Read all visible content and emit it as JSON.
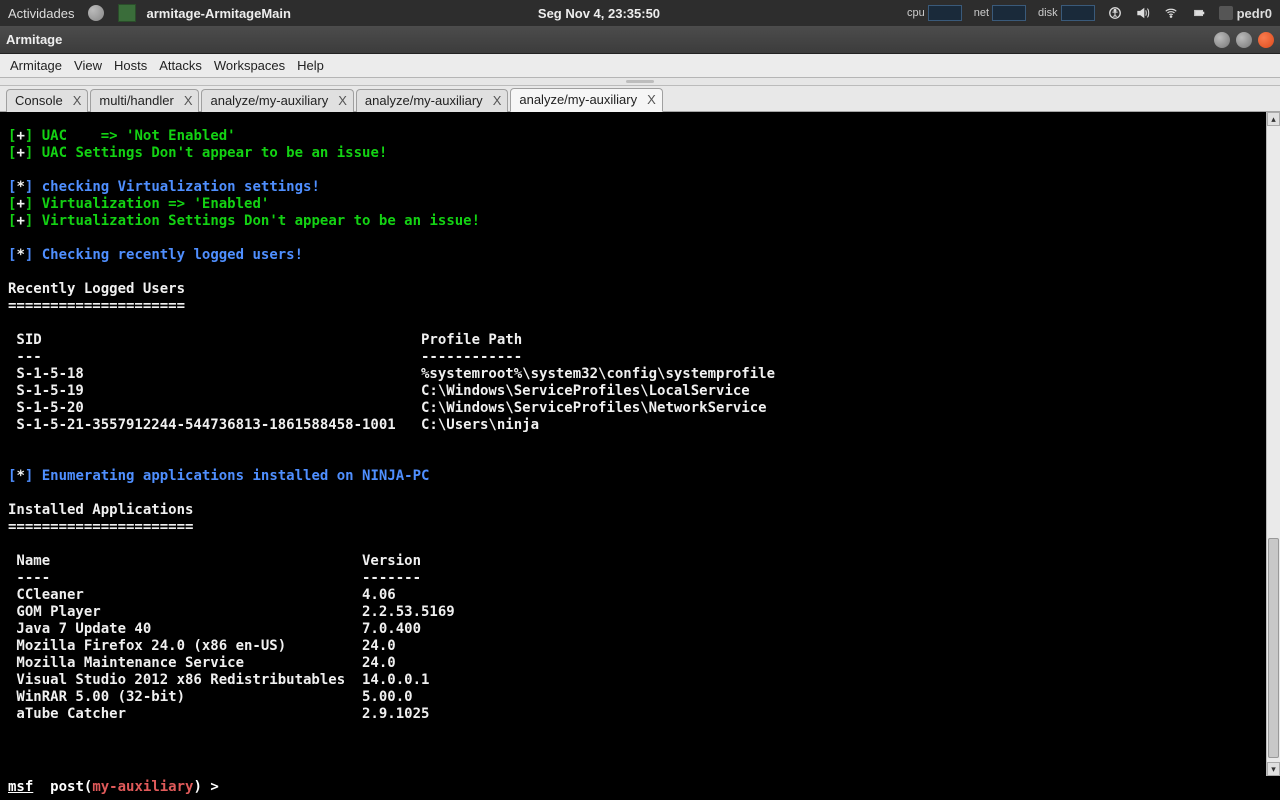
{
  "gnome": {
    "activities": "Actividades",
    "task_title": "armitage-ArmitageMain",
    "clock": "Seg Nov  4, 23:35:50",
    "indicators": {
      "cpu_label": "cpu",
      "net_label": "net",
      "disk_label": "disk"
    },
    "user": "pedr0"
  },
  "window": {
    "title": "Armitage"
  },
  "menu": {
    "items": [
      "Armitage",
      "View",
      "Hosts",
      "Attacks",
      "Workspaces",
      "Help"
    ]
  },
  "tabs": [
    {
      "label": "Console",
      "active": false
    },
    {
      "label": "multi/handler",
      "active": false
    },
    {
      "label": "analyze/my-auxiliary",
      "active": false
    },
    {
      "label": "analyze/my-auxiliary",
      "active": false
    },
    {
      "label": "analyze/my-auxiliary",
      "active": true
    }
  ],
  "console": {
    "lines": [
      {
        "t": "tag",
        "tag": "[+]",
        "text": "UAC    => 'Not Enabled'"
      },
      {
        "t": "tag",
        "tag": "[+]",
        "text": "UAC Settings Don't appear to be an issue!"
      },
      {
        "t": "blank"
      },
      {
        "t": "tag",
        "tag": "[*]",
        "text": "checking Virtualization settings!"
      },
      {
        "t": "tag",
        "tag": "[+]",
        "text": "Virtualization => 'Enabled'"
      },
      {
        "t": "tag",
        "tag": "[+]",
        "text": "Virtualization Settings Don't appear to be an issue!"
      },
      {
        "t": "blank"
      },
      {
        "t": "tag",
        "tag": "[*]",
        "text": "Checking recently logged users!"
      },
      {
        "t": "blank"
      }
    ],
    "users_header": "Recently Logged Users",
    "users_rule": "=====================",
    "users_table": {
      "col1_header": "SID",
      "col2_header": "Profile Path",
      "col1_dash": "---",
      "col2_dash": "------------",
      "rows": [
        {
          "sid": "S-1-5-18",
          "path": "%systemroot%\\system32\\config\\systemprofile"
        },
        {
          "sid": "S-1-5-19",
          "path": "C:\\Windows\\ServiceProfiles\\LocalService"
        },
        {
          "sid": "S-1-5-20",
          "path": "C:\\Windows\\ServiceProfiles\\NetworkService"
        },
        {
          "sid": "S-1-5-21-3557912244-544736813-1861588458-1001",
          "path": "C:\\Users\\ninja"
        }
      ],
      "col1_width": 48
    },
    "enum_line": {
      "tag": "[*]",
      "text": "Enumerating applications installed on NINJA-PC"
    },
    "apps_header": "Installed Applications",
    "apps_rule": "======================",
    "apps_table": {
      "col1_header": "Name",
      "col2_header": "Version",
      "col1_dash": "----",
      "col2_dash": "-------",
      "rows": [
        {
          "name": "CCleaner",
          "ver": "4.06"
        },
        {
          "name": "GOM Player",
          "ver": "2.2.53.5169"
        },
        {
          "name": "Java 7 Update 40",
          "ver": "7.0.400"
        },
        {
          "name": "Mozilla Firefox 24.0 (x86 en-US)",
          "ver": "24.0"
        },
        {
          "name": "Mozilla Maintenance Service",
          "ver": "24.0"
        },
        {
          "name": "Visual Studio 2012 x86 Redistributables",
          "ver": "14.0.0.1"
        },
        {
          "name": "WinRAR 5.00 (32-bit)",
          "ver": "5.00.0"
        },
        {
          "name": "aTube Catcher",
          "ver": "2.9.1025"
        }
      ],
      "col1_width": 41
    }
  },
  "prompt": {
    "msf": "msf",
    "post": "post",
    "module": "my-auxiliary",
    "gt": ">"
  }
}
